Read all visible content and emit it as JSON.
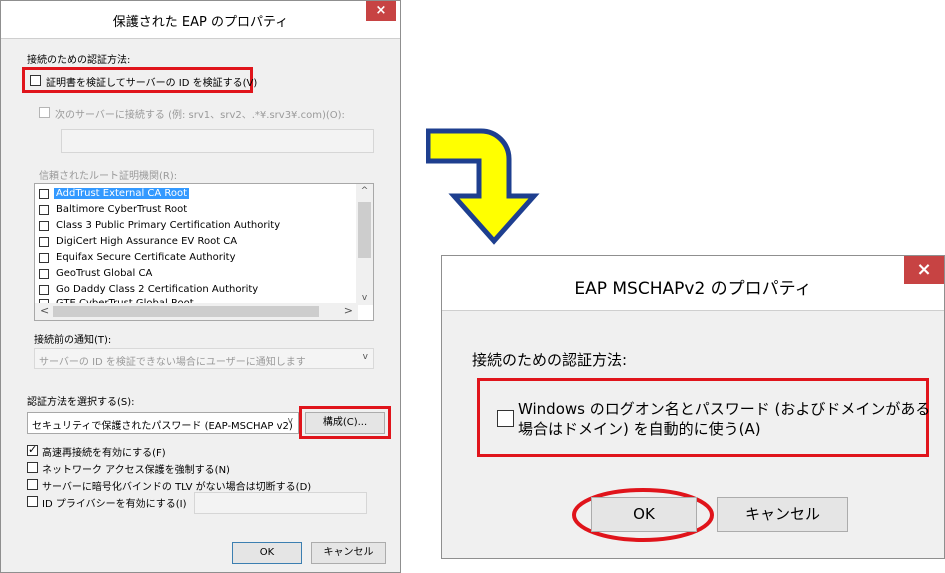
{
  "dialog1": {
    "title": "保護された EAP のプロパティ",
    "close_glyph": "×",
    "auth_method_label": "接続のための認証方法:",
    "verify_cert_label": "証明書を検証してサーバーの ID を検証する(V)",
    "connect_servers_label": "次のサーバーに接続する (例: srv1、srv2、.*¥.srv3¥.com)(O):",
    "trusted_root_label": "信頼されたルート証明機関(R):",
    "trusted_roots": [
      {
        "label": "AddTrust External CA Root",
        "selected": true
      },
      {
        "label": "Baltimore CyberTrust Root",
        "selected": false
      },
      {
        "label": "Class 3 Public Primary Certification Authority",
        "selected": false
      },
      {
        "label": "DigiCert High Assurance EV Root CA",
        "selected": false
      },
      {
        "label": "Equifax Secure Certificate Authority",
        "selected": false
      },
      {
        "label": "GeoTrust Global CA",
        "selected": false
      },
      {
        "label": "Go Daddy Class 2 Certification Authority",
        "selected": false
      },
      {
        "label": "GTE CyberTrust Global Root",
        "selected": false
      }
    ],
    "pre_connect_label": "接続前の通知(T):",
    "pre_connect_value": "サーバーの ID を検証できない場合にユーザーに通知します",
    "select_method_label": "認証方法を選択する(S):",
    "method_value": "セキュリティで保護されたパスワード (EAP-MSCHAP v2)",
    "configure_button": "構成(C)...",
    "fast_reconnect_label": "高速再接続を有効にする(F)",
    "nap_label": "ネットワーク アクセス保護を強制する(N)",
    "tlv_label": "サーバーに暗号化バインドの TLV がない場合は切断する(D)",
    "id_privacy_label": "ID プライバシーを有効にする(I)",
    "ok_button": "OK",
    "cancel_button": "キャンセル"
  },
  "dialog2": {
    "title": "EAP MSCHAPv2 のプロパティ",
    "close_glyph": "×",
    "auth_method_label": "接続のための認証方法:",
    "windows_logon_line1": "Windows のログオン名とパスワード (およびドメインがある",
    "windows_logon_line2": "場合はドメイン) を自動的に使う(A)",
    "ok_button": "OK",
    "cancel_button": "キャンセル"
  },
  "colors": {
    "highlight_red": "#e0141b",
    "arrow_yellow": "#ffff00",
    "arrow_outline": "#1e3f8f",
    "selection_blue": "#3399ff",
    "close_red": "#c74343"
  }
}
